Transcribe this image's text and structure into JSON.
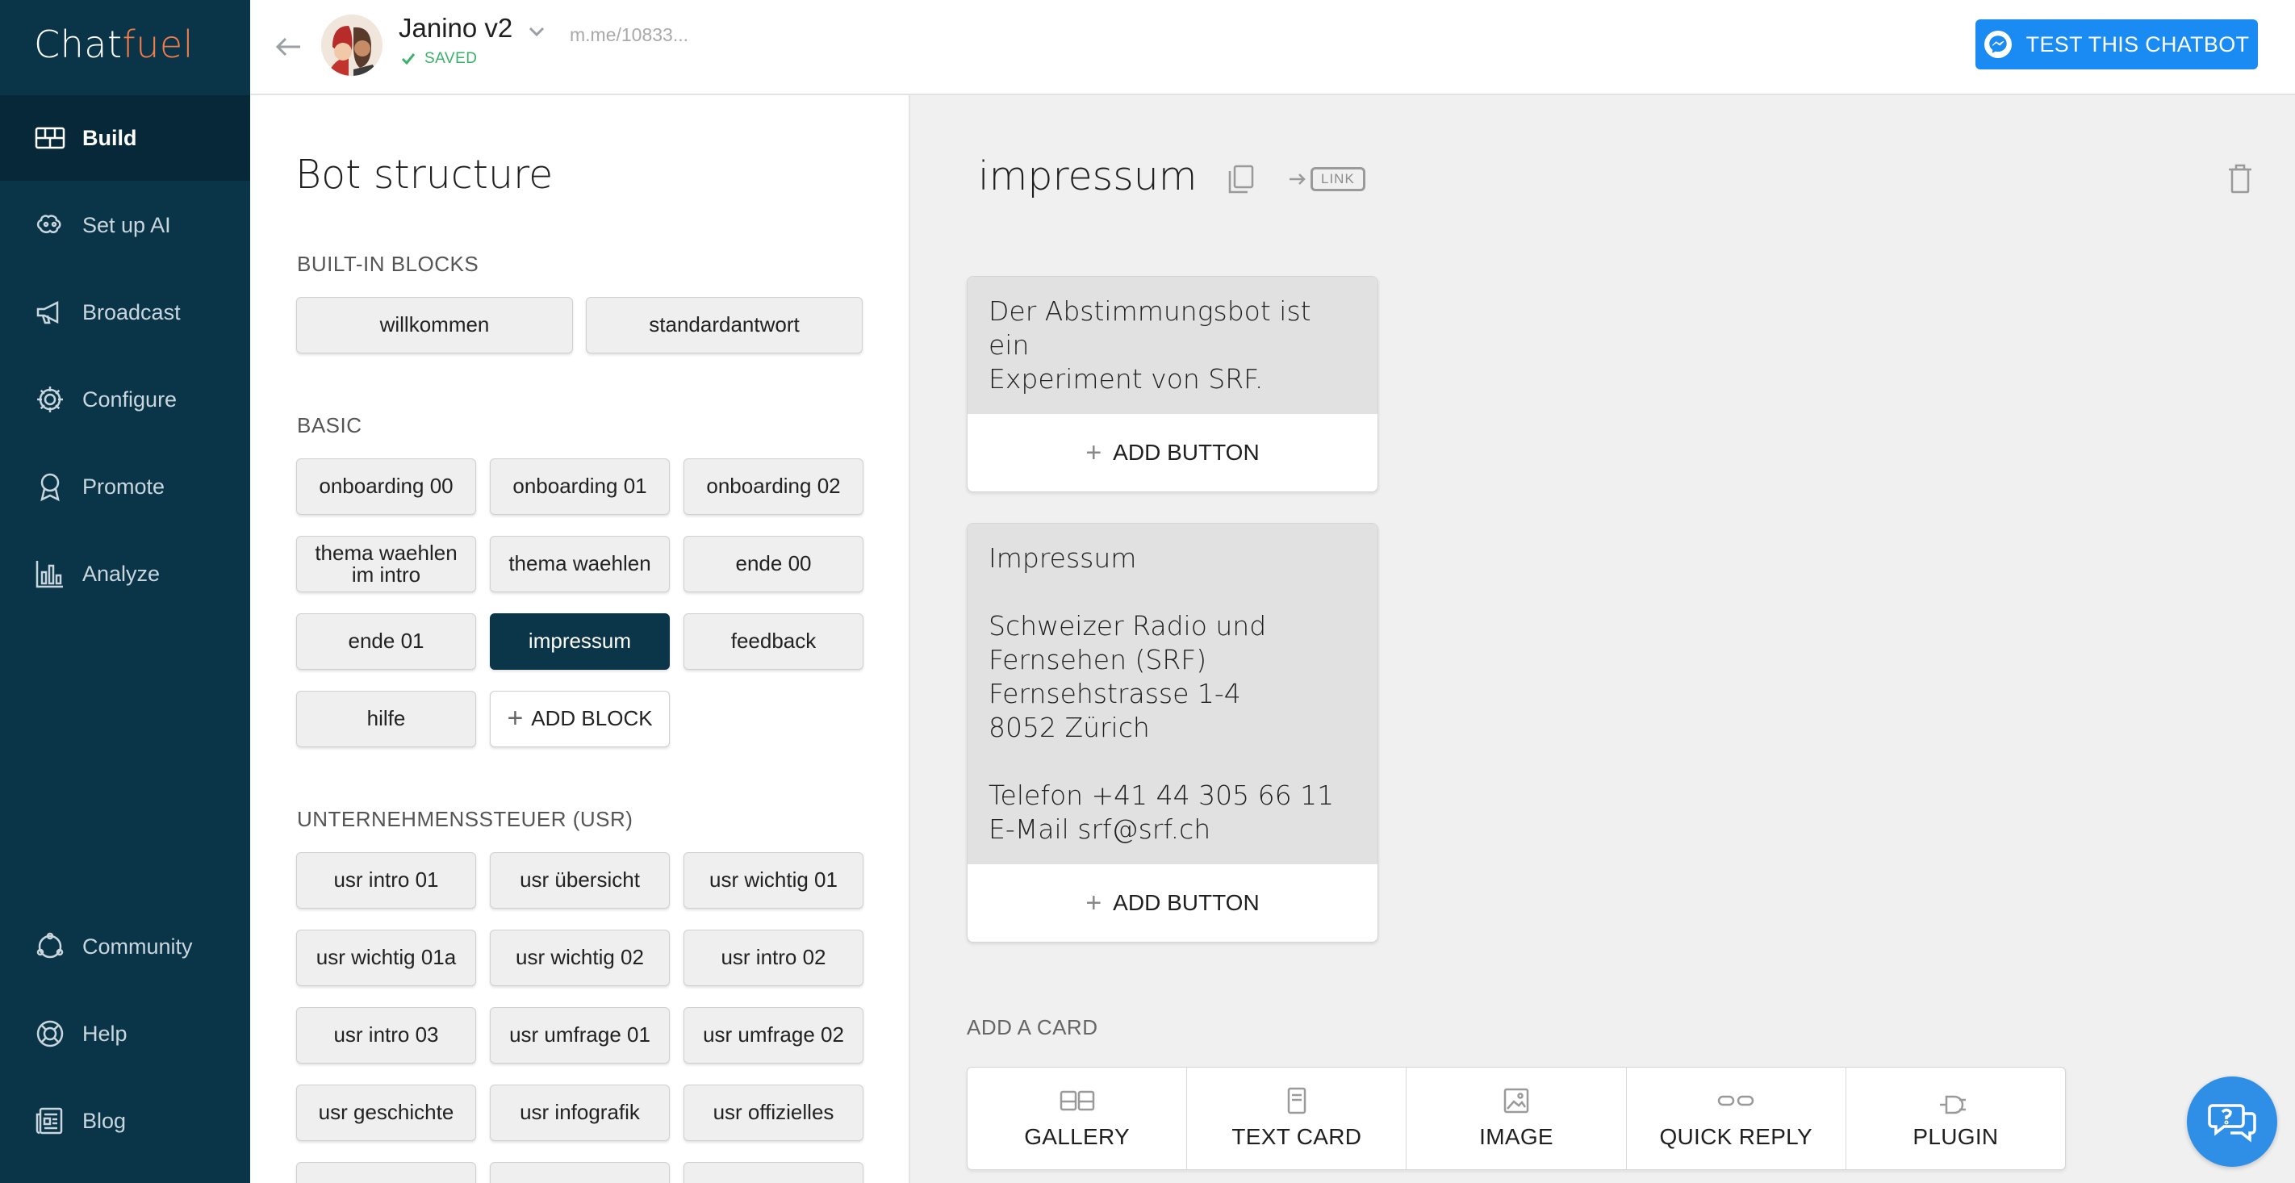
{
  "app": {
    "logo_left": "Chat",
    "logo_right": "fuel"
  },
  "nav": {
    "build": "Build",
    "setup_ai": "Set up AI",
    "broadcast": "Broadcast",
    "configure": "Configure",
    "promote": "Promote",
    "analyze": "Analyze",
    "community": "Community",
    "help": "Help",
    "blog": "Blog"
  },
  "topbar": {
    "bot_name": "Janino v2",
    "saved": "SAVED",
    "bot_link": "m.me/10833...",
    "test_button": "TEST THIS CHATBOT"
  },
  "structure": {
    "title": "Bot structure",
    "sections": {
      "builtin": {
        "title": "BUILT-IN BLOCKS",
        "blocks": [
          "willkommen",
          "standardantwort"
        ]
      },
      "basic": {
        "title": "BASIC",
        "blocks": [
          "onboarding 00",
          "onboarding 01",
          "onboarding 02",
          "thema waehlen im intro",
          "thema waehlen",
          "ende 00",
          "ende 01",
          "impressum",
          "feedback",
          "hilfe"
        ],
        "add_block": "ADD BLOCK",
        "selected": "impressum"
      },
      "usr": {
        "title": "UNTERNEHMENSSTEUER (USR)",
        "blocks": [
          "usr intro 01",
          "usr übersicht",
          "usr wichtig 01",
          "usr wichtig 01a",
          "usr wichtig 02",
          "usr intro 02",
          "usr intro 03",
          "usr umfrage 01",
          "usr umfrage 02",
          "usr geschichte",
          "usr infografik",
          "usr offizielles"
        ]
      }
    }
  },
  "editor": {
    "block_title": "impressum",
    "link_label": "LINK",
    "cards": [
      {
        "text": "Der Abstimmungsbot ist ein\nExperiment von SRF.",
        "add_button": "ADD BUTTON"
      },
      {
        "text": "Impressum\n\nSchweizer Radio und\nFernsehen (SRF)\nFernsehstrasse 1-4\n8052 Zürich\n\nTelefon +41 44 305 66 11\nE-Mail srf@srf.ch",
        "add_button": "ADD BUTTON"
      }
    ],
    "add_card_label": "ADD A CARD",
    "card_types": [
      "GALLERY",
      "TEXT CARD",
      "IMAGE",
      "QUICK REPLY",
      "PLUGIN"
    ]
  },
  "colors": {
    "sidebar": "#0a3548",
    "accent_orange": "#f47c4a",
    "test_button": "#1a8bf2",
    "selected_block": "#0b3548",
    "saved_green": "#3ab26a"
  }
}
